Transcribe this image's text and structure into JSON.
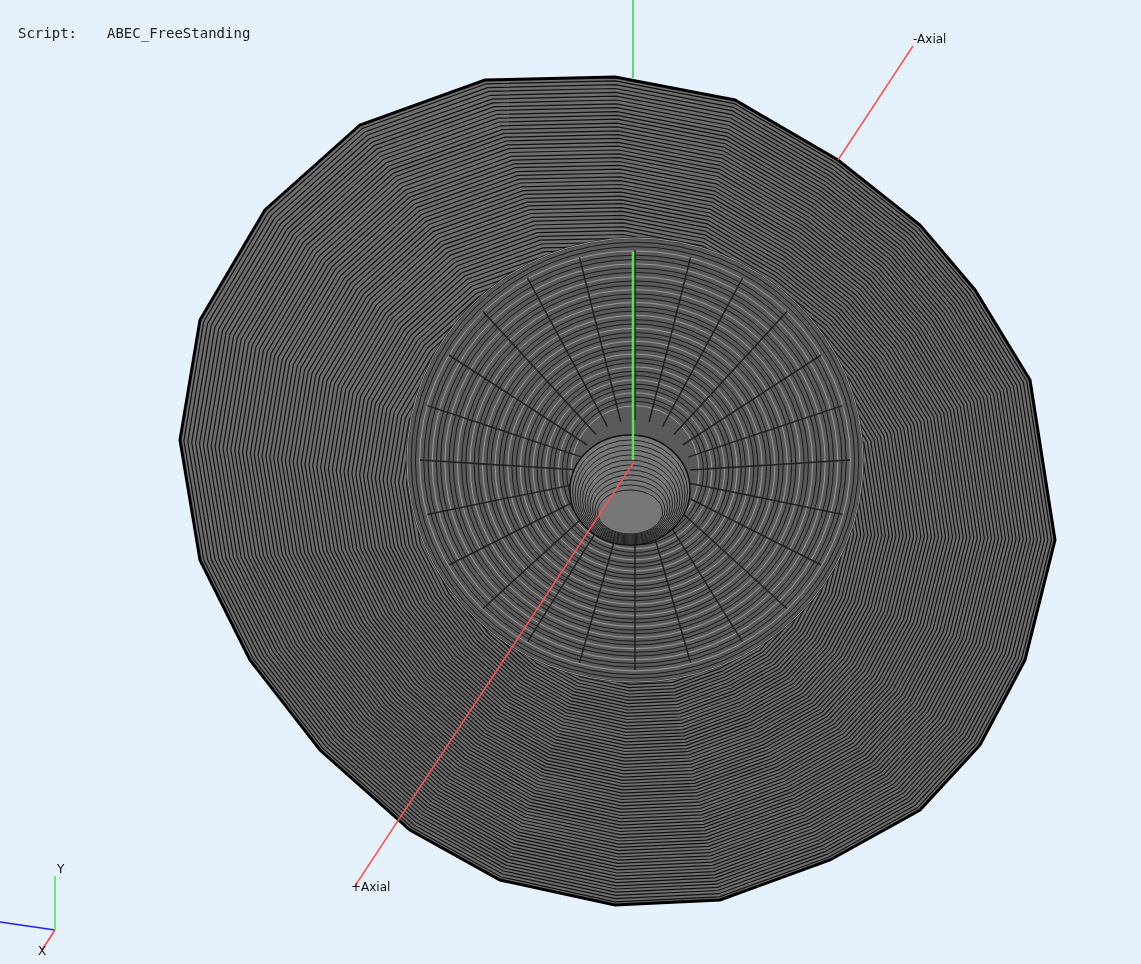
{
  "info": {
    "label": "Script:",
    "value": "ABEC_FreeStanding"
  },
  "axis_labels": [
    {
      "kind": "minus",
      "text": "-Axial"
    },
    {
      "kind": "plus",
      "text": "+Axial"
    }
  ],
  "triad": {
    "labels": [
      {
        "kind": "y",
        "text": "Y"
      },
      {
        "kind": "x",
        "text": "X"
      }
    ]
  }
}
